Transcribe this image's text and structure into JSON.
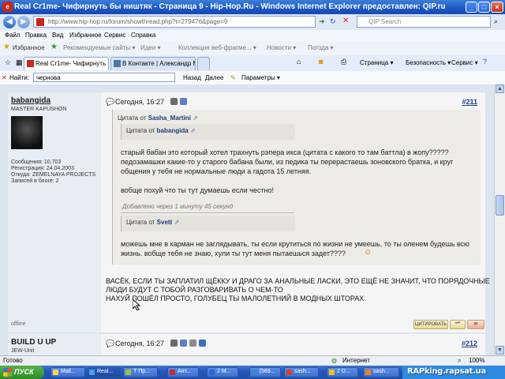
{
  "window": {
    "title": "Real Cr1me- Чифирнуть бы ништяк - Страница 9 - Hip-Hop.Ru - Windows Internet Explorer предоставлен: QIP.ru",
    "app_icon": "QIP"
  },
  "address": {
    "url": "http://www.hip-hop.ru/forum/showthread.php?t=279476&page=9",
    "search_placeholder": "QIP Search"
  },
  "menu": [
    "Файл",
    "Правка",
    "Вид",
    "Избранное",
    "Сервис",
    "Справка"
  ],
  "favorites": {
    "label": "Избранное",
    "items": [
      "Рекомендуемые сайты ▾",
      "Идеи ▾",
      "Коллекция веб-фрагме... ▾",
      "Новости ▾",
      "Погода ▾"
    ]
  },
  "tabs": [
    {
      "label": "Real Cr1me- Чифирнуть ..."
    },
    {
      "label": "В Контакте | Александр М..."
    }
  ],
  "commands": {
    "page": "Страница ▾",
    "security": "Безопасность ▾",
    "tools": "Сервис ▾"
  },
  "findbar": {
    "label": "Найти:",
    "value": "чернова",
    "prev": "Назад",
    "next": "Далее",
    "options": "Параметры ▾"
  },
  "post1": {
    "username": "babangida",
    "user_title": "MASTER KAPUSHON",
    "stats": [
      "Сообщения: 10,703",
      "Регистрация: 24.04.2003",
      "Откуда: ZEMELNAYA PROJECTS",
      "Записей в блоге: 2"
    ],
    "offline": "offline",
    "date": "Сегодня, 16:27",
    "number": "#211",
    "quote1_head_prefix": "Цитата от",
    "quote1_author": "Sasha_Martini",
    "quote2_head_prefix": "Цитата от",
    "quote2_author": "babangida",
    "quote2_lines": [
      "старый бабан это который хотел трахнуть рэпера икса (цитата с какого то там баттла) в жопу?????",
      "педозамашки какие-то у старого бабана были, из педика ты перерастаешь зоновского братка, и круг",
      "общения у тебя не нормальные люди а гадота 15 летняя."
    ],
    "quote2_line2": "вобще похуй что ты тут думаешь если честно!",
    "added_note": "Добавлено через 1 минуту 45 секунд",
    "quote3_head_prefix": "Цитата от",
    "quote3_author": "Svett",
    "quote3_lines": [
      "можешь мне в карман не заглядывать. ты если крутиться по жизни не умеешь, то ты оленем будешь всю",
      "жизнь. вобще тебя не знаю, хули ты тут меня пытаешься задет????"
    ],
    "reply_lines": [
      "ВАСЁК, ЕСЛИ ТЫ ЗАПЛАТИЛ ЩЁККУ И ДРАГО ЗА АНАЛЬНЫЕ ЛАСКИ, ЭТО ЕЩЁ НЕ ЗНАЧИТ, ЧТО ПОРЯДОЧНЫЕ",
      "ЛЮДИ БУДУТ С ТОБОЙ РАЗГОВАРИВАТЬ О ЧЕМ-ТО",
      "НАХУЙ ПОШЁЛ ПРОСТО, ГОЛУБЕЦ ТЫ МАЛОЛЕТНИЙ В МОДНЫХ ШТОРАХ"
    ],
    "quote_button": "ЦИТИРОВАТЬ"
  },
  "post2": {
    "username": "BUILD U UP",
    "user_title": "JEW-Unit",
    "date": "Сегодня, 16:27",
    "number": "#212"
  },
  "status": {
    "left": "Готово",
    "zone": "Интернет",
    "zoom": "100%"
  },
  "taskbar": {
    "start": "ПУСК",
    "items": [
      "Mail...",
      "Real...",
      "Т Пр...",
      "Ант...",
      "2 M...",
      "[569...",
      "sash...",
      "2 D...",
      "sash..."
    ],
    "tray_text": "RAPking.rapsat.ua"
  },
  "colors": {
    "titlebar": "#1d57c4",
    "post_number": "#1c3f94",
    "page_bg": "#dbe4ef"
  }
}
